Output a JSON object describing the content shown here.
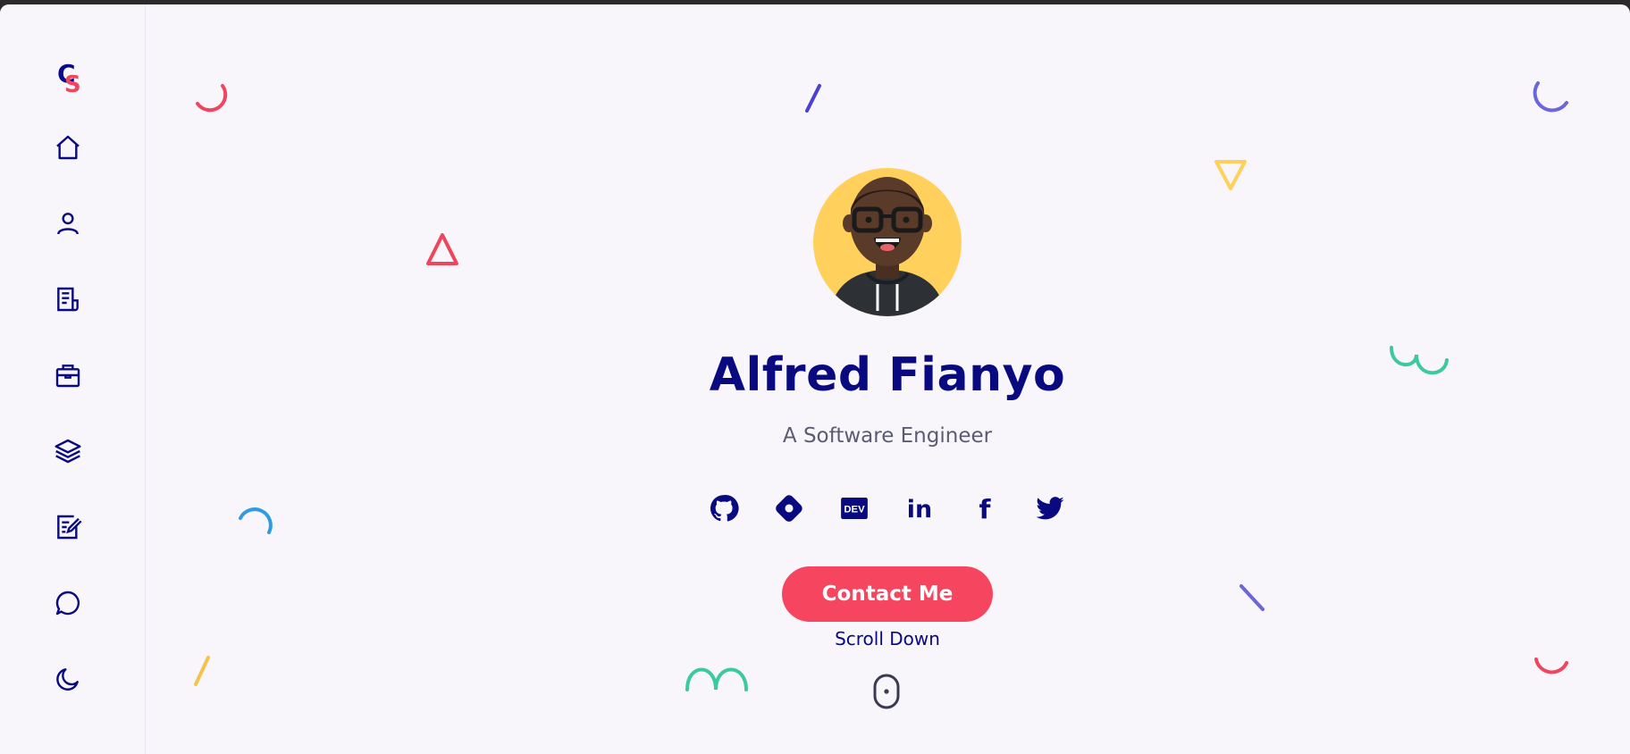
{
  "profile": {
    "name": "Alfred Fianyo",
    "role": "A Software Engineer"
  },
  "actions": {
    "contact_label": "Contact Me",
    "scroll_label": "Scroll Down"
  },
  "sidebar": {
    "logo": {
      "letter_top": "C",
      "letter_bottom": "S"
    },
    "items": [
      {
        "icon": "home-icon"
      },
      {
        "icon": "user-icon"
      },
      {
        "icon": "resume-icon"
      },
      {
        "icon": "briefcase-icon"
      },
      {
        "icon": "layers-icon"
      },
      {
        "icon": "edit-note-icon"
      },
      {
        "icon": "chat-icon"
      },
      {
        "icon": "moon-icon"
      }
    ]
  },
  "socials": [
    {
      "icon": "github-icon"
    },
    {
      "icon": "hashnode-icon"
    },
    {
      "icon": "dev-icon",
      "text": "DEV"
    },
    {
      "icon": "linkedin-icon",
      "text": "in"
    },
    {
      "icon": "facebook-icon",
      "text": "f"
    },
    {
      "icon": "twitter-icon"
    }
  ],
  "colors": {
    "primary": "#0a0a80",
    "accent": "#f6465f",
    "background": "#f8f6fb",
    "avatar_bg": "#ffd15c"
  }
}
